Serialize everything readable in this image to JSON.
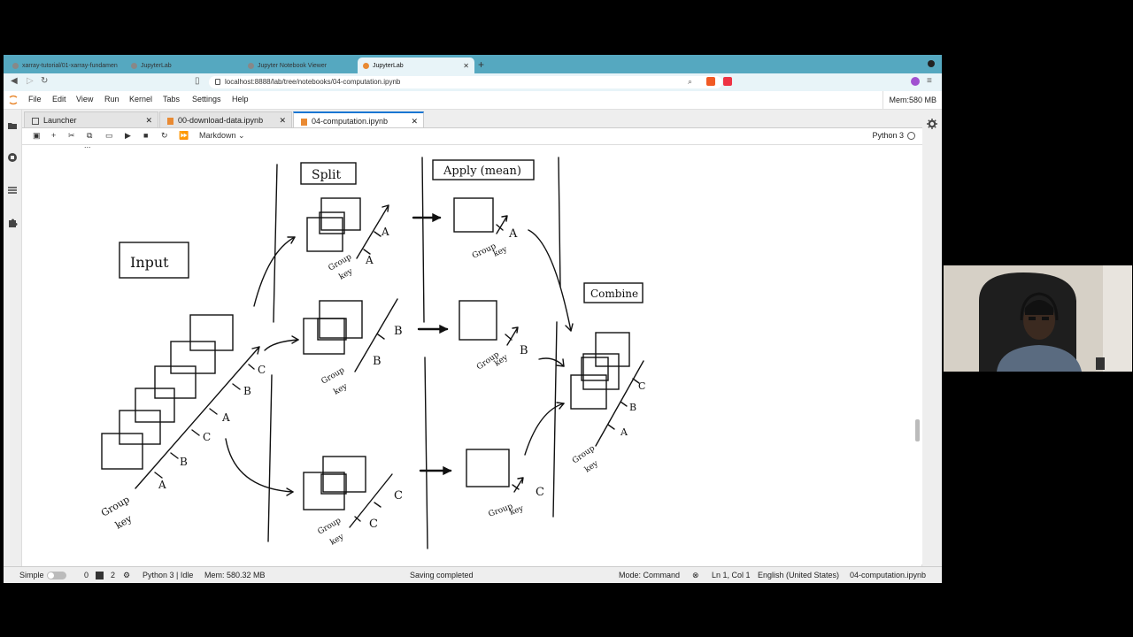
{
  "browser": {
    "tabs": [
      {
        "label": "xarray-tutorial/01-xarray-fundamen"
      },
      {
        "label": "JupyterLab"
      },
      {
        "label": "Jupyter Notebook Viewer"
      },
      {
        "label": "JupyterLab",
        "active": true
      }
    ],
    "url": "localhost:8888/lab/tree/notebooks/04-computation.ipynb"
  },
  "menubar": {
    "items": [
      "File",
      "Edit",
      "View",
      "Run",
      "Kernel",
      "Tabs",
      "Settings",
      "Help"
    ],
    "memory": "Mem:580 MB"
  },
  "doc_tabs": [
    {
      "label": "Launcher"
    },
    {
      "label": "00-download-data.ipynb"
    },
    {
      "label": "04-computation.ipynb",
      "active": true
    }
  ],
  "toolbar": {
    "cell_type": "Markdown",
    "kernel": "Python 3"
  },
  "notebook": {
    "cell_text": "..."
  },
  "sketch": {
    "headers": [
      "Split",
      "Apply (mean)",
      "Combine"
    ],
    "input_label": "Input",
    "group_key": [
      "Group",
      "key"
    ],
    "keys": [
      "A",
      "B",
      "C"
    ]
  },
  "statusbar": {
    "mode_label": "Simple",
    "terminals": "0",
    "kernels": "2",
    "kernel_status": "Python 3 | Idle",
    "mem": "Mem: 580.32 MB",
    "saving": "Saving completed",
    "mode": "Mode: Command",
    "position": "Ln 1, Col 1",
    "language": "English (United States)",
    "filename": "04-computation.ipynb"
  },
  "colors": {
    "browser_tabbar": "#55a8c0",
    "jupyter_accent": "#1976d2",
    "notebook_icon": "#e98a33"
  }
}
